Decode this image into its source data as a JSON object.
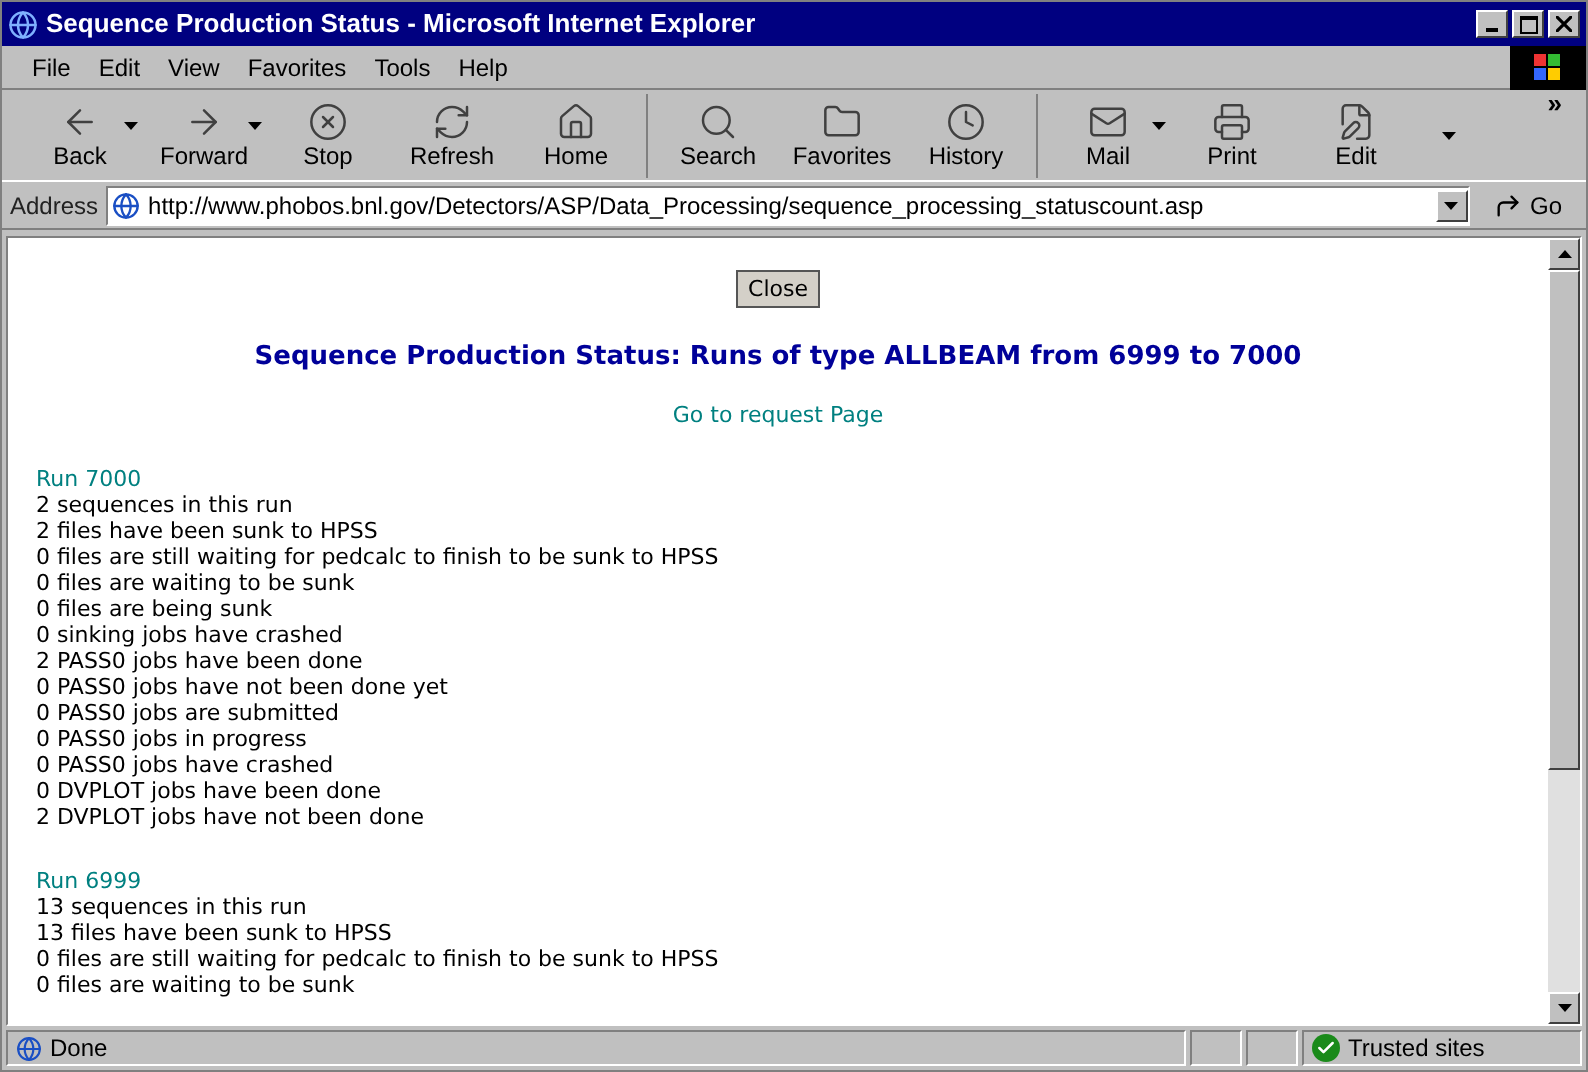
{
  "window": {
    "title": "Sequence Production Status - Microsoft Internet Explorer"
  },
  "menu": [
    "File",
    "Edit",
    "View",
    "Favorites",
    "Tools",
    "Help"
  ],
  "toolbar": {
    "groups": [
      [
        {
          "label": "Back",
          "dropdown": true
        },
        {
          "label": "Forward",
          "dropdown": true
        },
        {
          "label": "Stop",
          "dropdown": false
        },
        {
          "label": "Refresh",
          "dropdown": false
        },
        {
          "label": "Home",
          "dropdown": false
        }
      ],
      [
        {
          "label": "Search",
          "dropdown": false
        },
        {
          "label": "Favorites",
          "dropdown": false
        },
        {
          "label": "History",
          "dropdown": false
        }
      ],
      [
        {
          "label": "Mail",
          "dropdown": true
        },
        {
          "label": "Print",
          "dropdown": false
        },
        {
          "label": "Edit",
          "dropdown": false
        }
      ]
    ],
    "more": "»"
  },
  "address": {
    "label": "Address",
    "value": "http://www.phobos.bnl.gov/Detectors/ASP/Data_Processing/sequence_processing_statuscount.asp",
    "go": "Go"
  },
  "page": {
    "close_button": "Close",
    "heading": "Sequence Production Status: Runs of type ALLBEAM from 6999 to 7000",
    "link": "Go to request Page",
    "runs": [
      {
        "title": "Run 7000",
        "lines": [
          "2 sequences in this run",
          "2 files have been sunk to HPSS",
          "0 files are still waiting for pedcalc to finish to be sunk to HPSS",
          "0 files are waiting to be sunk",
          "0 files are being sunk",
          "0 sinking jobs have crashed",
          "2 PASS0 jobs have been done",
          "0 PASS0 jobs have not been done yet",
          "0 PASS0 jobs are submitted",
          "0 PASS0 jobs in progress",
          "0 PASS0 jobs have crashed",
          "0 DVPLOT jobs have been done",
          "2 DVPLOT jobs have not been done"
        ]
      },
      {
        "title": "Run 6999",
        "lines": [
          "13 sequences in this run",
          "13 files have been sunk to HPSS",
          "0 files are still waiting for pedcalc to finish to be sunk to HPSS",
          "0 files are waiting to be sunk"
        ]
      }
    ]
  },
  "status_bar": {
    "text": "Done",
    "zone": "Trusted sites"
  }
}
